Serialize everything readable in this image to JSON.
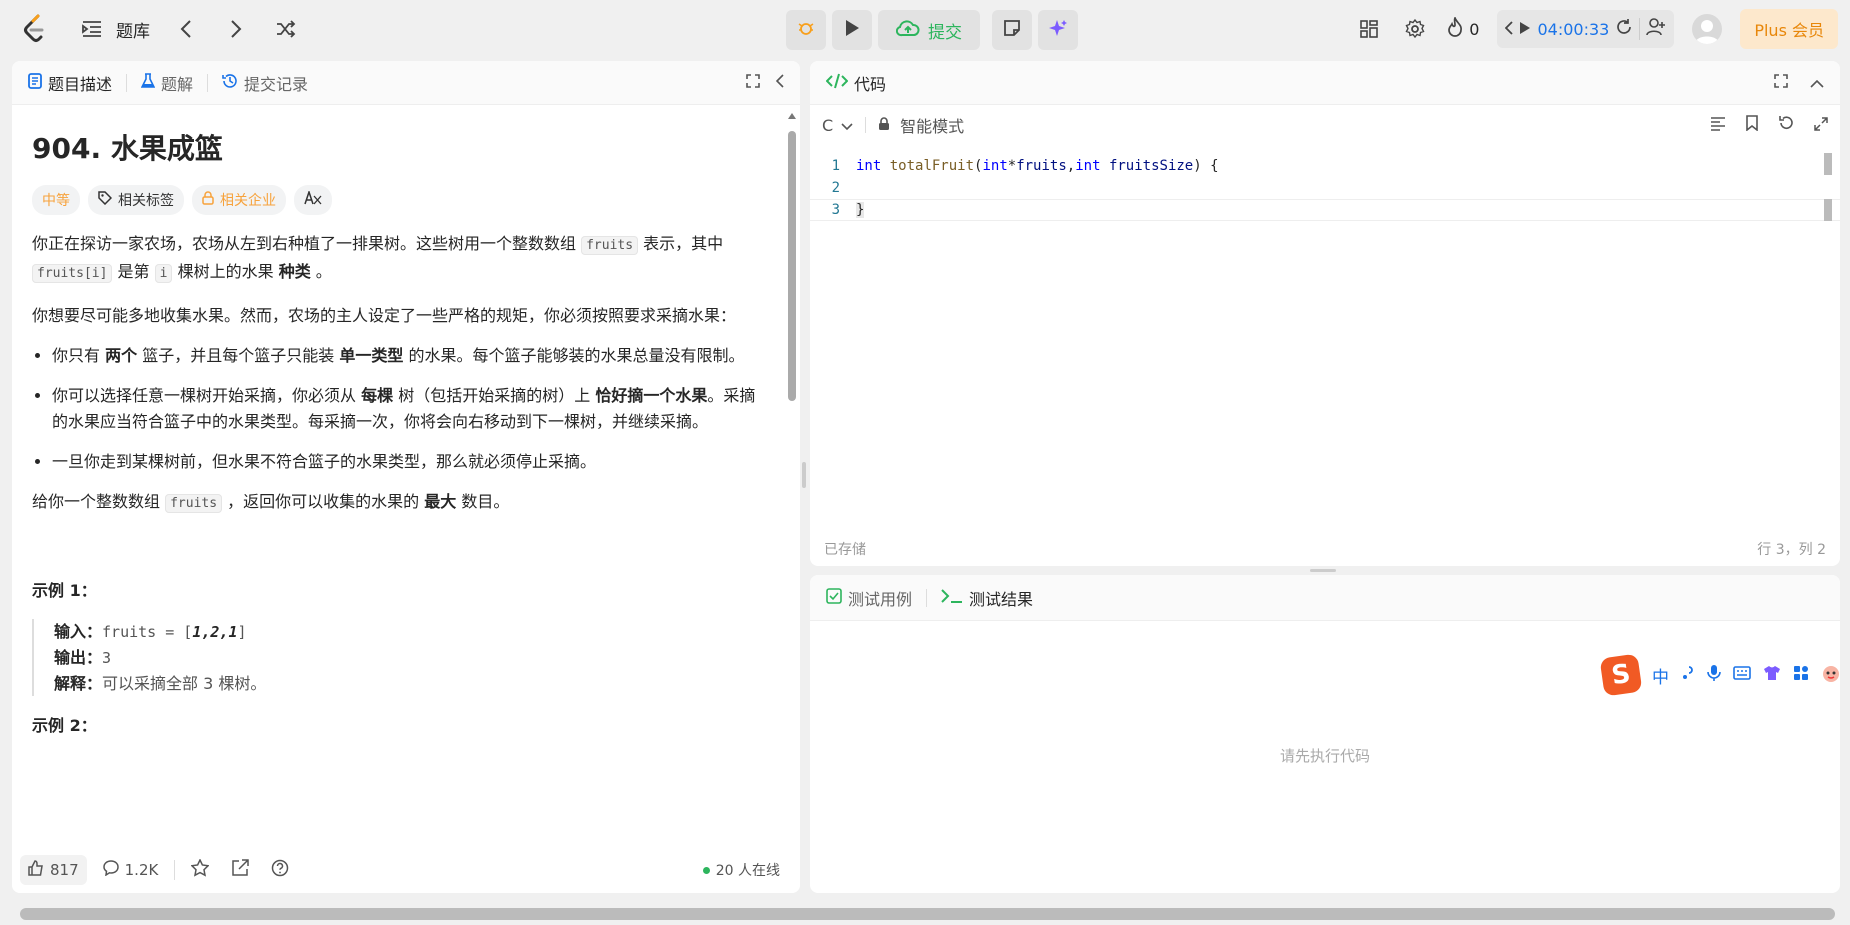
{
  "topbar": {
    "title": "题库",
    "submit_label": "提交",
    "streak_count": "0",
    "timer": "04:00:33",
    "plus_label": "Plus 会员"
  },
  "left_panel": {
    "tabs": [
      {
        "label": "题目描述",
        "active": true
      },
      {
        "label": "题解",
        "active": false
      },
      {
        "label": "提交记录",
        "active": false
      }
    ],
    "problem_title": "904. 水果成篮",
    "tags": {
      "difficulty": "中等",
      "topics": "相关标签",
      "companies": "相关企业"
    },
    "desc": {
      "p1_a": "你正在探访一家农场，农场从左到右种植了一排果树。这些树用一个整数数组",
      "p1_code1": "fruits",
      "p1_b": "表示，其中",
      "p1_code2": "fruits[i]",
      "p1_c": "是第",
      "p1_code3": "i",
      "p1_d": "棵树上的水果",
      "p1_bold": "种类",
      "p1_e": "。",
      "p2": "你想要尽可能多地收集水果。然而，农场的主人设定了一些严格的规矩，你必须按照要求采摘水果：",
      "li1_a": "你只有",
      "li1_b1": "两个",
      "li1_b": "篮子，并且每个篮子只能装",
      "li1_b2": "单一类型",
      "li1_c": "的水果。每个篮子能够装的水果总量没有限制。",
      "li2_a": "你可以选择任意一棵树开始采摘，你必须从",
      "li2_b1": "每棵",
      "li2_b": "树（包括开始采摘的树）上",
      "li2_b2": "恰好摘一个水果",
      "li2_c": "。采摘的水果应当符合篮子中的水果类型。每采摘一次，你将会向右移动到下一棵树，并继续采摘。",
      "li3": "一旦你走到某棵树前，但水果不符合篮子的水果类型，那么就必须停止采摘。",
      "p3_a": "给你一个整数数组",
      "p3_code": "fruits",
      "p3_b": "，返回你可以收集的水果的",
      "p3_bold": "最大",
      "p3_c": "数目。"
    },
    "example1": {
      "heading": "示例 1：",
      "input_label": "输入：",
      "input_value_a": "fruits = [",
      "input_value_b": "1,2,1",
      "input_value_c": "]",
      "output_label": "输出：",
      "output_value": "3",
      "explain_label": "解释：",
      "explain_value": "可以采摘全部 3 棵树。"
    },
    "example2_heading": "示例 2：",
    "footer": {
      "likes": "817",
      "comments": "1.2K",
      "online": "20 人在线"
    }
  },
  "code_panel": {
    "title": "代码",
    "language": "C",
    "mode": "智能模式",
    "lines": [
      {
        "num": "1"
      },
      {
        "num": "2"
      },
      {
        "num": "3"
      }
    ],
    "code": {
      "int1": "int",
      "fn": "totalFruit",
      "p1": "(",
      "int2": "int",
      "star": "* ",
      "arg1": "fruits",
      "comma": ", ",
      "int3": "int",
      "arg2": "fruitsSize",
      "p2": ") {",
      "close": "}"
    },
    "saved": "已存储",
    "cursor": "行 3，列 2"
  },
  "test_panel": {
    "tabs": [
      {
        "label": "测试用例",
        "active": false
      },
      {
        "label": "测试结果",
        "active": true
      }
    ],
    "placeholder": "请先执行代码"
  },
  "ime": {
    "logo": "S",
    "lang": "中"
  },
  "colors": {
    "accent_green": "#2db55d",
    "timer_blue": "#1a73e8",
    "medium_orange": "#f7a23b",
    "plus_bg": "#fde8cc"
  }
}
